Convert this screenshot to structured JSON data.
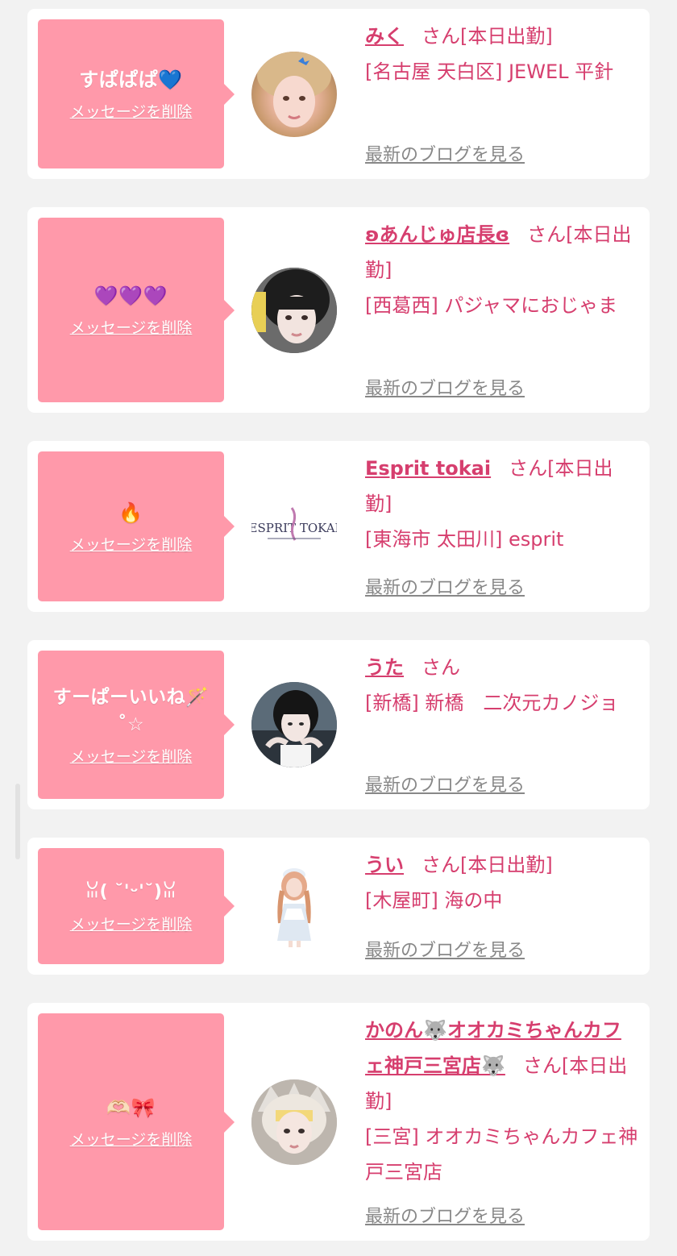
{
  "accent_pink": "#ff99aa",
  "text_pink": "#d63e6e",
  "cards": [
    {
      "message": "すぱぱぱ💙",
      "delete_label": "メッセージを削除",
      "name": "みく",
      "status": "さん[本日出勤]",
      "area": "[名古屋 天白区] JEWEL 平針",
      "blog_label": "最新のブログを見る",
      "avatar_icon": "profile-photo"
    },
    {
      "message": "💜💜💜",
      "delete_label": "メッセージを削除",
      "name": "ʚあんじゅ店長ɞ",
      "status": "さん[本日出勤]",
      "area": "[西葛西] パジャマにおじゃま",
      "blog_label": "最新のブログを見る",
      "avatar_icon": "profile-photo"
    },
    {
      "message": "🔥",
      "delete_label": "メッセージを削除",
      "name": "Esprit tokai",
      "status": "さん[本日出勤]",
      "area": "[東海市 太田川] esprit",
      "blog_label": "最新のブログを見る",
      "avatar_icon": "esprit-logo",
      "logo_text": "ESPRIT TOKAI"
    },
    {
      "message": "すーぱーいいね🪄˚☆",
      "delete_label": "メッセージを削除",
      "name": "うた",
      "status": "さん",
      "area": "[新橋] 新橋　二次元カノジョ",
      "blog_label": "最新のブログを見る",
      "avatar_icon": "profile-photo"
    },
    {
      "message": "ꈍ( ˘'ᵕ'˘)ꈍ",
      "delete_label": "メッセージを削除",
      "name": "うい",
      "status": "さん[本日出勤]",
      "area": "[木屋町] 海の中",
      "blog_label": "最新のブログを見る",
      "avatar_icon": "profile-photo"
    },
    {
      "message": "🫶🏻🎀",
      "delete_label": "メッセージを削除",
      "name": "かのん🐺オオカミちゃんカフェ神戸三宮店🐺",
      "status": "さん[本日出勤]",
      "area": "[三宮] オオカミちゃんカフェ神戸三宮店",
      "blog_label": "最新のブログを見る",
      "avatar_icon": "profile-photo"
    }
  ]
}
